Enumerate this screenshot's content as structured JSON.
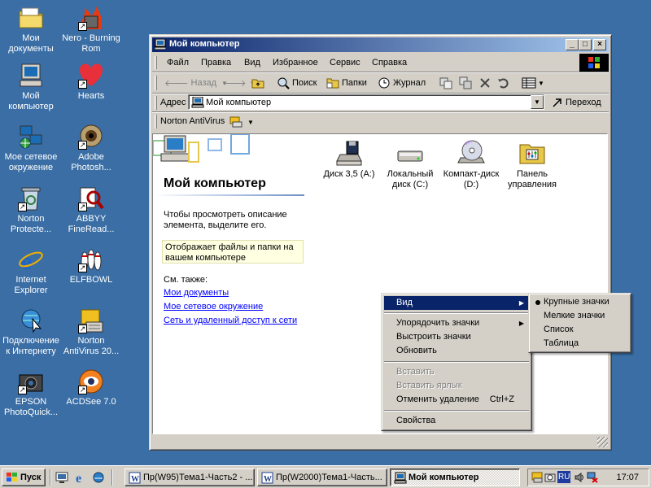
{
  "desktop": {
    "icons": [
      {
        "label": "Мои документы"
      },
      {
        "label": "Nero - Burning Rom"
      },
      {
        "label": "Мой компьютер"
      },
      {
        "label": "Hearts"
      },
      {
        "label": "Мое сетевое окружение"
      },
      {
        "label": "Adobe Photosh..."
      },
      {
        "label": "Norton Protecte..."
      },
      {
        "label": "ABBYY FineRead..."
      },
      {
        "label": "Internet Explorer"
      },
      {
        "label": "ELFBOWL"
      },
      {
        "label": "Подключение к Интернету"
      },
      {
        "label": "Norton AntiVirus 20..."
      },
      {
        "label": "EPSON PhotoQuick..."
      },
      {
        "label": "ACDSee 7.0"
      }
    ]
  },
  "window": {
    "title": "Мой компьютер",
    "controls": {
      "minimize": "_",
      "maximize": "□",
      "close": "×"
    },
    "menu": [
      "Файл",
      "Правка",
      "Вид",
      "Избранное",
      "Сервис",
      "Справка"
    ],
    "toolbar": {
      "back": "Назад",
      "search": "Поиск",
      "folders": "Папки",
      "history": "Журнал"
    },
    "address": {
      "label": "Адрес",
      "value": "Мой компьютер",
      "go": "Переход"
    },
    "norton_bar": {
      "label": "Norton AntiVirus"
    },
    "content": {
      "title": "Мой компьютер",
      "description": "Чтобы просмотреть описание элемента, выделите его.",
      "info": "Отображает файлы и папки на вашем компьютере",
      "see_also": "См. также:",
      "links": [
        "Мои документы",
        "Мое сетевое окружение",
        "Сеть и удаленный доступ к сети"
      ],
      "items": [
        {
          "label": "Диск 3,5 (A:)"
        },
        {
          "label": "Локальный диск (C:)"
        },
        {
          "label": "Компакт-диск (D:)"
        },
        {
          "label": "Панель управления"
        }
      ]
    }
  },
  "context_menu": {
    "items": [
      {
        "label": "Вид",
        "submenu": true,
        "selected": true
      },
      {
        "label": "Упорядочить значки",
        "submenu": true
      },
      {
        "label": "Выстроить значки"
      },
      {
        "label": "Обновить"
      },
      {
        "label": "Вставить",
        "disabled": true
      },
      {
        "label": "Вставить ярлык",
        "disabled": true
      },
      {
        "label": "Отменить удаление",
        "shortcut": "Ctrl+Z"
      },
      {
        "label": "Свойства"
      }
    ]
  },
  "view_submenu": {
    "items": [
      {
        "label": "Крупные значки",
        "checked": true
      },
      {
        "label": "Мелкие значки"
      },
      {
        "label": "Список"
      },
      {
        "label": "Таблица"
      }
    ]
  },
  "taskbar": {
    "start": "Пуск",
    "tasks": [
      {
        "label": "Пр(W95)Тема1-Часть2 - ..."
      },
      {
        "label": "Пр(W2000)Тема1-Часть..."
      },
      {
        "label": "Мой компьютер",
        "active": true
      }
    ],
    "tray": {
      "lang": "RU",
      "clock": "17:07"
    }
  },
  "colors": {
    "desktop": "#3a6ea5",
    "title_active": "#0a246a",
    "face": "#d4d0c8",
    "highlight": "#0a246a",
    "link": "#0000ff"
  }
}
